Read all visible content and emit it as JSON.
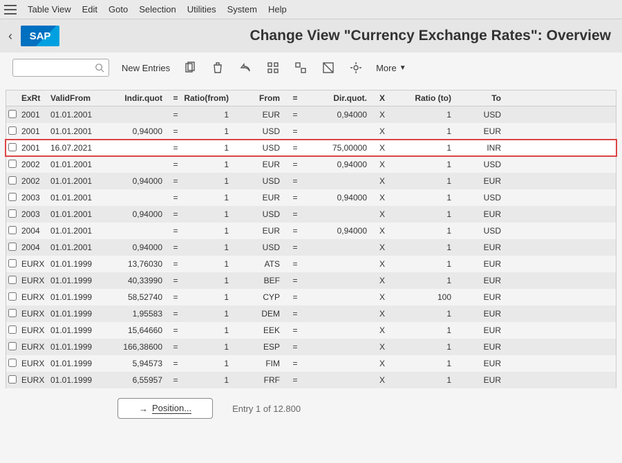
{
  "menu": {
    "items": [
      "Table View",
      "Edit",
      "Goto",
      "Selection",
      "Utilities",
      "System",
      "Help"
    ]
  },
  "titlebar": {
    "title": "Change View \"Currency Exchange Rates\": Overview",
    "logo": "SAP"
  },
  "toolbar": {
    "new_entries": "New Entries",
    "more": "More"
  },
  "columns": {
    "exrt": "ExRt",
    "valid_from": "ValidFrom",
    "indir_quot": "Indir.quot",
    "eq": "=",
    "ratio_from": "Ratio(from)",
    "from": "From",
    "dir_quot": "Dir.quot.",
    "x": "X",
    "ratio_to": "Ratio (to)",
    "to": "To"
  },
  "rows": [
    {
      "exrt": "2001",
      "valid": "01.01.2001",
      "iq": "",
      "rf": "1",
      "from": "EUR",
      "dq": "0,94000",
      "x": "X",
      "rt": "1",
      "to": "USD"
    },
    {
      "exrt": "2001",
      "valid": "01.01.2001",
      "iq": "0,94000",
      "rf": "1",
      "from": "USD",
      "dq": "",
      "x": "X",
      "rt": "1",
      "to": "EUR"
    },
    {
      "exrt": "2001",
      "valid": "16.07.2021",
      "iq": "",
      "rf": "1",
      "from": "USD",
      "dq": "75,00000",
      "x": "X",
      "rt": "1",
      "to": "INR",
      "hl": true
    },
    {
      "exrt": "2002",
      "valid": "01.01.2001",
      "iq": "",
      "rf": "1",
      "from": "EUR",
      "dq": "0,94000",
      "x": "X",
      "rt": "1",
      "to": "USD"
    },
    {
      "exrt": "2002",
      "valid": "01.01.2001",
      "iq": "0,94000",
      "rf": "1",
      "from": "USD",
      "dq": "",
      "x": "X",
      "rt": "1",
      "to": "EUR"
    },
    {
      "exrt": "2003",
      "valid": "01.01.2001",
      "iq": "",
      "rf": "1",
      "from": "EUR",
      "dq": "0,94000",
      "x": "X",
      "rt": "1",
      "to": "USD"
    },
    {
      "exrt": "2003",
      "valid": "01.01.2001",
      "iq": "0,94000",
      "rf": "1",
      "from": "USD",
      "dq": "",
      "x": "X",
      "rt": "1",
      "to": "EUR"
    },
    {
      "exrt": "2004",
      "valid": "01.01.2001",
      "iq": "",
      "rf": "1",
      "from": "EUR",
      "dq": "0,94000",
      "x": "X",
      "rt": "1",
      "to": "USD"
    },
    {
      "exrt": "2004",
      "valid": "01.01.2001",
      "iq": "0,94000",
      "rf": "1",
      "from": "USD",
      "dq": "",
      "x": "X",
      "rt": "1",
      "to": "EUR"
    },
    {
      "exrt": "EURX",
      "valid": "01.01.1999",
      "iq": "13,76030",
      "rf": "1",
      "from": "ATS",
      "dq": "",
      "x": "X",
      "rt": "1",
      "to": "EUR"
    },
    {
      "exrt": "EURX",
      "valid": "01.01.1999",
      "iq": "40,33990",
      "rf": "1",
      "from": "BEF",
      "dq": "",
      "x": "X",
      "rt": "1",
      "to": "EUR"
    },
    {
      "exrt": "EURX",
      "valid": "01.01.1999",
      "iq": "58,52740",
      "rf": "1",
      "from": "CYP",
      "dq": "",
      "x": "X",
      "rt": "100",
      "to": "EUR"
    },
    {
      "exrt": "EURX",
      "valid": "01.01.1999",
      "iq": "1,95583",
      "rf": "1",
      "from": "DEM",
      "dq": "",
      "x": "X",
      "rt": "1",
      "to": "EUR"
    },
    {
      "exrt": "EURX",
      "valid": "01.01.1999",
      "iq": "15,64660",
      "rf": "1",
      "from": "EEK",
      "dq": "",
      "x": "X",
      "rt": "1",
      "to": "EUR"
    },
    {
      "exrt": "EURX",
      "valid": "01.01.1999",
      "iq": "166,38600",
      "rf": "1",
      "from": "ESP",
      "dq": "",
      "x": "X",
      "rt": "1",
      "to": "EUR"
    },
    {
      "exrt": "EURX",
      "valid": "01.01.1999",
      "iq": "5,94573",
      "rf": "1",
      "from": "FIM",
      "dq": "",
      "x": "X",
      "rt": "1",
      "to": "EUR"
    },
    {
      "exrt": "EURX",
      "valid": "01.01.1999",
      "iq": "6,55957",
      "rf": "1",
      "from": "FRF",
      "dq": "",
      "x": "X",
      "rt": "1",
      "to": "EUR"
    }
  ],
  "footer": {
    "position_btn": "Position...",
    "entry_info": "Entry 1 of 12.800"
  }
}
